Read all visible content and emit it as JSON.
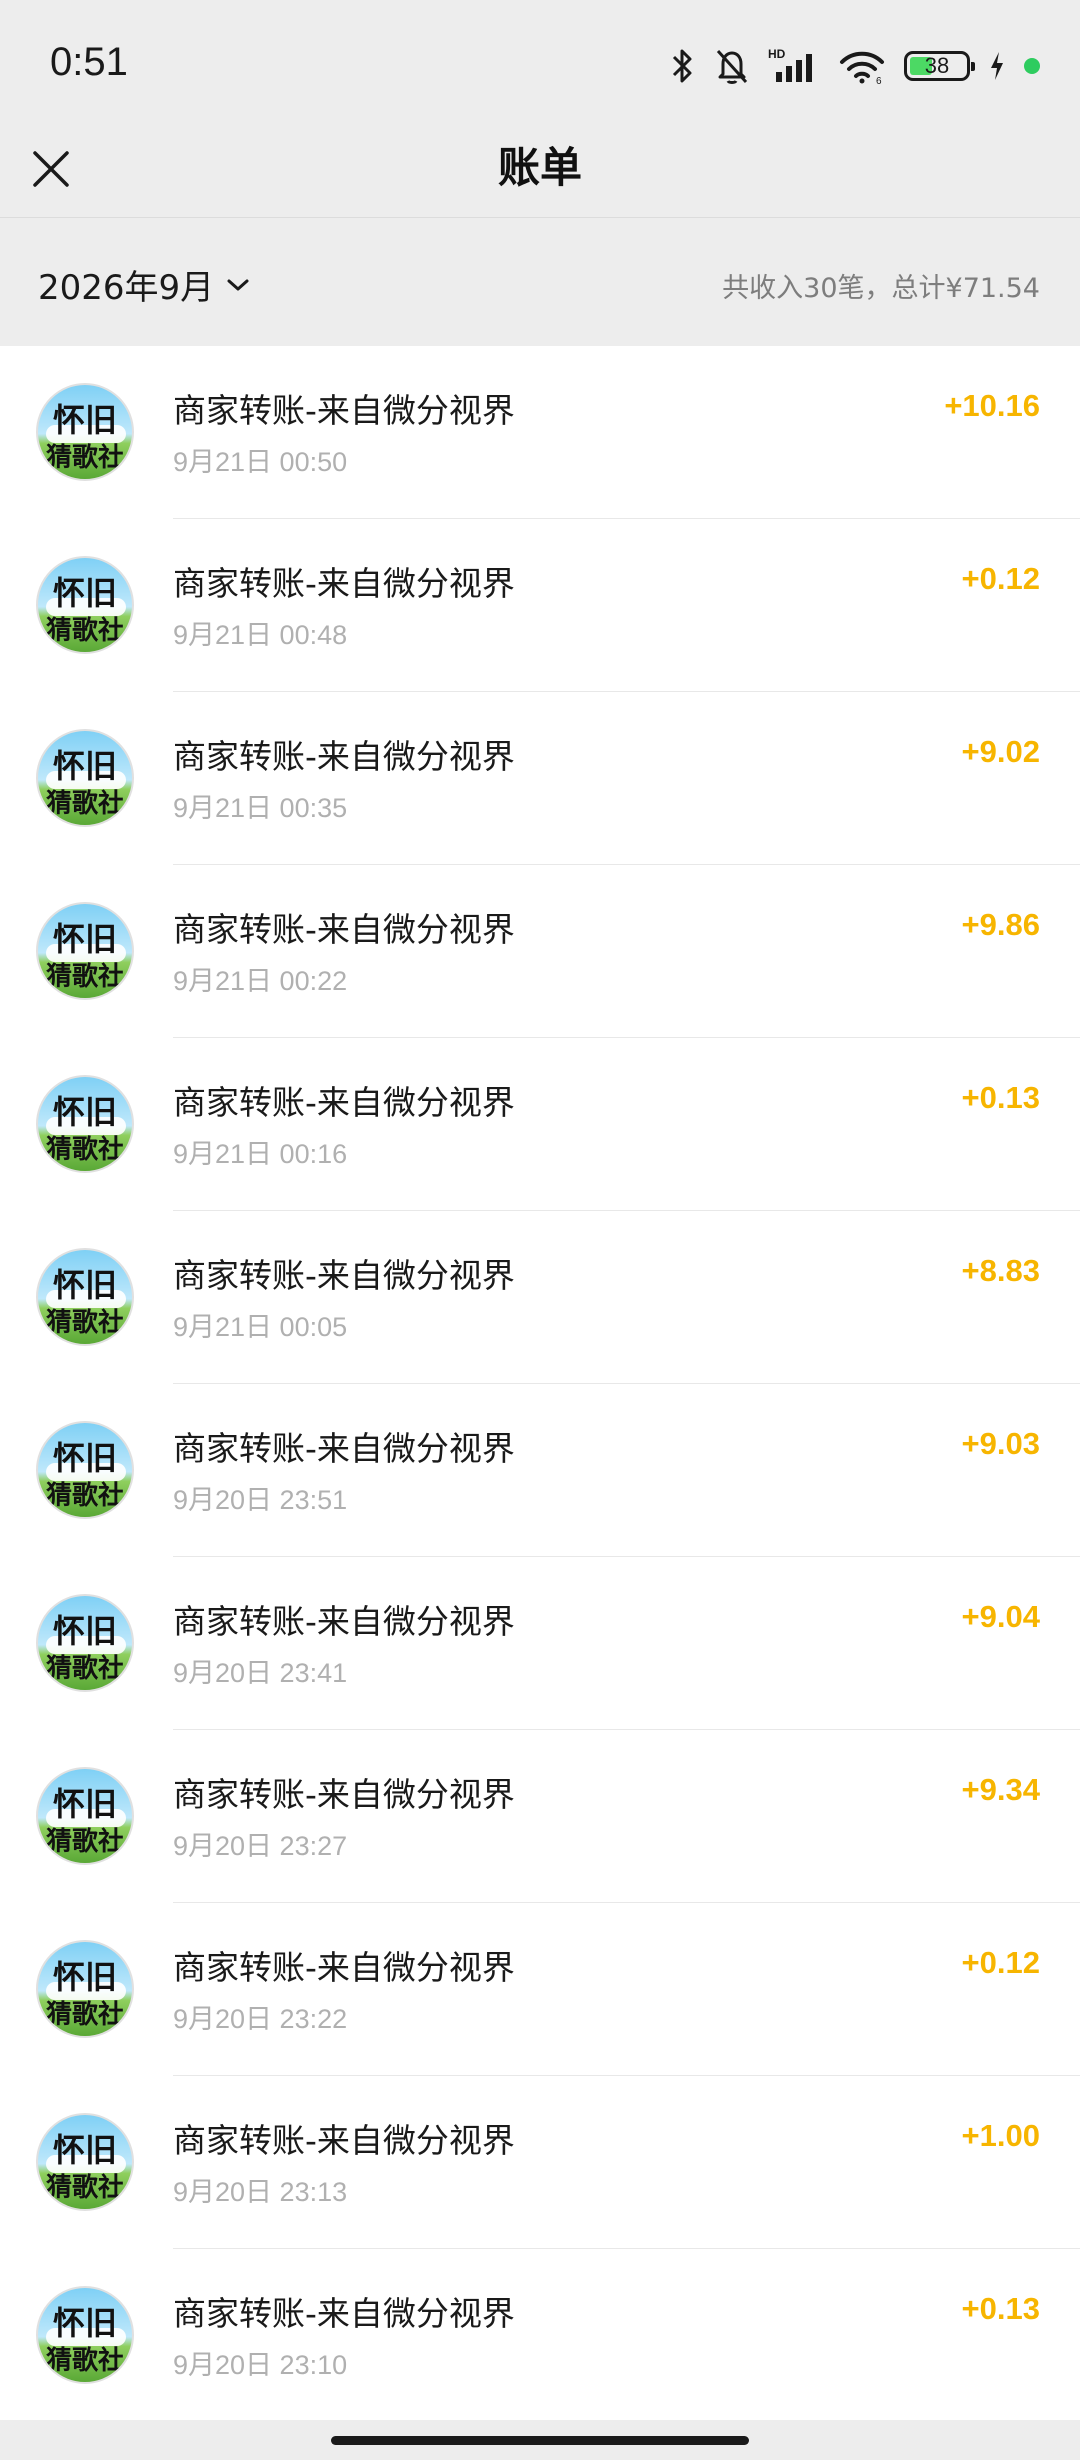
{
  "status_bar": {
    "time": "0:51",
    "battery_level": "38",
    "icons": [
      "bluetooth-icon",
      "bell-muted-icon",
      "hd-signal-icon",
      "wifi-icon",
      "battery-icon",
      "charging-icon"
    ]
  },
  "nav": {
    "title": "账单",
    "close_icon": "close-icon"
  },
  "summary": {
    "month": "2026年9月",
    "stats": "共收入30笔，总计¥71.54"
  },
  "colors": {
    "amount": "#f7b500",
    "background": "#ededed"
  },
  "transactions": [
    {
      "avatar_line1": "怀旧",
      "avatar_line2": "猜歌社",
      "title": "商家转账-来自微分视界",
      "time": "9月21日 00:50",
      "amount": "+10.16"
    },
    {
      "avatar_line1": "怀旧",
      "avatar_line2": "猜歌社",
      "title": "商家转账-来自微分视界",
      "time": "9月21日 00:48",
      "amount": "+0.12"
    },
    {
      "avatar_line1": "怀旧",
      "avatar_line2": "猜歌社",
      "title": "商家转账-来自微分视界",
      "time": "9月21日 00:35",
      "amount": "+9.02"
    },
    {
      "avatar_line1": "怀旧",
      "avatar_line2": "猜歌社",
      "title": "商家转账-来自微分视界",
      "time": "9月21日 00:22",
      "amount": "+9.86"
    },
    {
      "avatar_line1": "怀旧",
      "avatar_line2": "猜歌社",
      "title": "商家转账-来自微分视界",
      "time": "9月21日 00:16",
      "amount": "+0.13"
    },
    {
      "avatar_line1": "怀旧",
      "avatar_line2": "猜歌社",
      "title": "商家转账-来自微分视界",
      "time": "9月21日 00:05",
      "amount": "+8.83"
    },
    {
      "avatar_line1": "怀旧",
      "avatar_line2": "猜歌社",
      "title": "商家转账-来自微分视界",
      "time": "9月20日 23:51",
      "amount": "+9.03"
    },
    {
      "avatar_line1": "怀旧",
      "avatar_line2": "猜歌社",
      "title": "商家转账-来自微分视界",
      "time": "9月20日 23:41",
      "amount": "+9.04"
    },
    {
      "avatar_line1": "怀旧",
      "avatar_line2": "猜歌社",
      "title": "商家转账-来自微分视界",
      "time": "9月20日 23:27",
      "amount": "+9.34"
    },
    {
      "avatar_line1": "怀旧",
      "avatar_line2": "猜歌社",
      "title": "商家转账-来自微分视界",
      "time": "9月20日 23:22",
      "amount": "+0.12"
    },
    {
      "avatar_line1": "怀旧",
      "avatar_line2": "猜歌社",
      "title": "商家转账-来自微分视界",
      "time": "9月20日 23:13",
      "amount": "+1.00"
    },
    {
      "avatar_line1": "怀旧",
      "avatar_line2": "猜歌社",
      "title": "商家转账-来自微分视界",
      "time": "9月20日 23:10",
      "amount": "+0.13"
    }
  ]
}
